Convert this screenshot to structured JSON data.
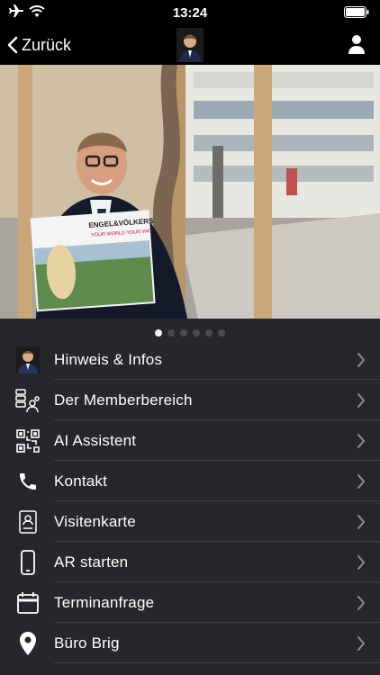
{
  "status_bar": {
    "time": "13:24"
  },
  "nav": {
    "back_label": "Zurück"
  },
  "hero": {
    "brand_line1": "ENGEL&VÖLKERS",
    "brand_line2": "YOUR WORLD YOUR WAY"
  },
  "carousel": {
    "count": 6,
    "active": 0
  },
  "menu": {
    "items": [
      {
        "label": "Hinweis & Infos",
        "icon": "person-portrait-icon"
      },
      {
        "label": "Der Memberbereich",
        "icon": "members-area-icon"
      },
      {
        "label": "AI Assistent",
        "icon": "qr-code-icon"
      },
      {
        "label": "Kontakt",
        "icon": "phone-icon"
      },
      {
        "label": "Visitenkarte",
        "icon": "business-card-icon"
      },
      {
        "label": "AR starten",
        "icon": "smartphone-icon"
      },
      {
        "label": "Terminanfrage",
        "icon": "calendar-icon"
      },
      {
        "label": "Büro Brig",
        "icon": "location-pin-icon"
      }
    ]
  },
  "colors": {
    "background": "#26272b",
    "bars": "#000000",
    "divider": "#3d3e43"
  }
}
